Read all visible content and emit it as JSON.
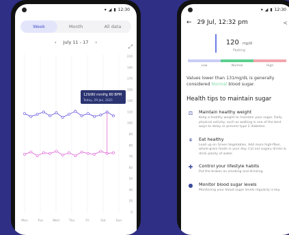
{
  "left_phone": {
    "status_time": "12:30",
    "segments": [
      "Week",
      "Month",
      "All data"
    ],
    "range_label": "July 11 - 17",
    "tooltip": {
      "line1_value": "129/80",
      "line1_unit": "mmHg",
      "line1_extra": "80 BPM",
      "line2": "Today, 29 Jan, 2021"
    },
    "x_labels": [
      "Mon",
      "Tue",
      "Wed",
      "Thu",
      "Fri",
      "Sat",
      "Sun"
    ],
    "y_labels": [
      "210",
      "190",
      "170",
      "150",
      "130",
      "110",
      "100",
      "90",
      "80",
      "70",
      "60",
      "50",
      "40",
      "20",
      "0"
    ]
  },
  "chart_data": {
    "type": "line",
    "x": [
      "Mon",
      "Tue",
      "Wed",
      "Thu",
      "Fri",
      "Sat",
      "Sun"
    ],
    "series": [
      {
        "color": "#6b5be0",
        "values": [
          132,
          128,
          131,
          134,
          129,
          133,
          127,
          131,
          135,
          129,
          132,
          128,
          130,
          134,
          129
        ]
      },
      {
        "color": "#e06bd8",
        "values": [
          78,
          81,
          76,
          80,
          79,
          82,
          77,
          80,
          76,
          81,
          79,
          78,
          82,
          79,
          80
        ]
      }
    ],
    "ylim": [
      0,
      210
    ]
  },
  "right_phone": {
    "status_time": "12:30",
    "title": "29 Jul, 12:32 pm",
    "reading_value": "120",
    "reading_unit": "mg/dl",
    "reading_sub": "Fasting",
    "bar_labels": [
      "Low",
      "Normal",
      "High"
    ],
    "bar_colors": [
      "#c9cdf5",
      "#5ccf8f",
      "#f2a6ac"
    ],
    "note_pre": "Values lower than 131mg/dL is generally considered",
    "note_hl": "Normal",
    "note_post": "blood sugar.",
    "tips_title": "Health tips to maintain sugar",
    "tips": [
      {
        "icon": "scale-icon",
        "glyph": "⚖",
        "title": "Maintain healthy weight",
        "text": "Keep a healthy weight to maintain your sugar. Daily physical activity, such as walking is one of the best ways to delay or prevent type 2 diabetes."
      },
      {
        "icon": "apple-icon",
        "glyph": "⚘",
        "title": "Eat healthy",
        "text": "Load up on Green Vegetables. Add more high-fiber, whole-grain foods in your day. Cut out sugary drinks & drink plenty of water."
      },
      {
        "icon": "pill-icon",
        "glyph": "✚",
        "title": "Control your lifestyle habits",
        "text": "Put the brakes on smoking and drinking."
      },
      {
        "icon": "drop-icon",
        "glyph": "●",
        "title": "Monitor blood sugar levels",
        "text": "Monitoring your blood sugar levels regularly is key."
      }
    ]
  }
}
